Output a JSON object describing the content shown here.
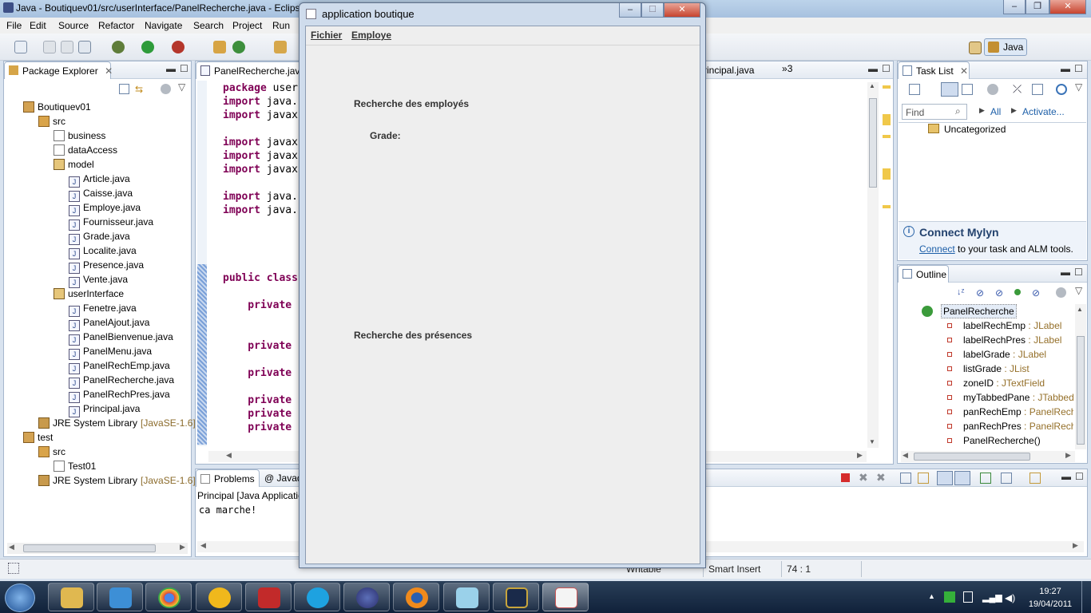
{
  "eclipse": {
    "title": "Java - Boutiquev01/src/userInterface/PanelRecherche.java - Eclipse",
    "menu": [
      "File",
      "Edit",
      "Source",
      "Refactor",
      "Navigate",
      "Search",
      "Project",
      "Run"
    ],
    "perspective": "Java",
    "package_explorer": {
      "title": "Package Explorer",
      "tree": [
        {
          "label": "Boutiquev01",
          "icon": "project-icon",
          "indent": 0
        },
        {
          "label": "src",
          "icon": "source-folder-icon",
          "indent": 1
        },
        {
          "label": "business",
          "icon": "empty-package-icon",
          "indent": 2
        },
        {
          "label": "dataAccess",
          "icon": "empty-package-icon",
          "indent": 2
        },
        {
          "label": "model",
          "icon": "package-icon",
          "indent": 2
        },
        {
          "label": "Article.java",
          "icon": "java-file-icon",
          "indent": 3
        },
        {
          "label": "Caisse.java",
          "icon": "java-file-icon",
          "indent": 3
        },
        {
          "label": "Employe.java",
          "icon": "java-file-icon",
          "indent": 3
        },
        {
          "label": "Fournisseur.java",
          "icon": "java-file-icon",
          "indent": 3
        },
        {
          "label": "Grade.java",
          "icon": "java-file-icon",
          "indent": 3
        },
        {
          "label": "Localite.java",
          "icon": "java-file-icon",
          "indent": 3
        },
        {
          "label": "Presence.java",
          "icon": "java-file-icon",
          "indent": 3
        },
        {
          "label": "Vente.java",
          "icon": "java-file-icon",
          "indent": 3
        },
        {
          "label": "userInterface",
          "icon": "package-icon",
          "indent": 2
        },
        {
          "label": "Fenetre.java",
          "icon": "java-file-icon",
          "indent": 3
        },
        {
          "label": "PanelAjout.java",
          "icon": "java-file-icon",
          "indent": 3
        },
        {
          "label": "PanelBienvenue.java",
          "icon": "java-file-icon",
          "indent": 3
        },
        {
          "label": "PanelMenu.java",
          "icon": "java-file-icon",
          "indent": 3
        },
        {
          "label": "PanelRechEmp.java",
          "icon": "java-file-icon",
          "indent": 3
        },
        {
          "label": "PanelRecherche.java",
          "icon": "java-file-icon",
          "indent": 3
        },
        {
          "label": "PanelRechPres.java",
          "icon": "java-file-icon",
          "indent": 3
        },
        {
          "label": "Principal.java",
          "icon": "java-file-icon",
          "indent": 3
        },
        {
          "label": "JRE System Library",
          "suffix": "[JavaSE-1.6]",
          "icon": "library-icon",
          "indent": 1
        },
        {
          "label": "test",
          "icon": "project-icon",
          "indent": 0
        },
        {
          "label": "src",
          "icon": "source-folder-icon",
          "indent": 1
        },
        {
          "label": "Test01",
          "icon": "empty-package-icon",
          "indent": 2
        },
        {
          "label": "JRE System Library",
          "suffix": "[JavaSE-1.6]",
          "icon": "library-icon",
          "indent": 1
        }
      ]
    },
    "editor": {
      "tab_active": "PanelRecherche.java",
      "tab_other": "rincipal.java",
      "tab_overflow": "3",
      "lines": [
        {
          "kw": "package",
          "rest": " user"
        },
        {
          "kw": "import",
          "rest": " java."
        },
        {
          "kw": "import",
          "rest": " javax"
        },
        {
          "kw": "",
          "rest": ""
        },
        {
          "kw": "import",
          "rest": " javax"
        },
        {
          "kw": "import",
          "rest": " javax"
        },
        {
          "kw": "import",
          "rest": " javax"
        },
        {
          "kw": "",
          "rest": ""
        },
        {
          "kw": "import",
          "rest": " java."
        },
        {
          "kw": "import",
          "rest": " java."
        },
        {
          "kw": "",
          "rest": ""
        },
        {
          "kw": "",
          "rest": ""
        },
        {
          "kw": "",
          "rest": ""
        },
        {
          "kw": "",
          "rest": ""
        },
        {
          "kw": "public class",
          "rest": ""
        },
        {
          "kw": "",
          "rest": ""
        },
        {
          "kw": "    private",
          "rest": ""
        },
        {
          "kw": "",
          "rest": ""
        },
        {
          "kw": "",
          "rest": ""
        },
        {
          "kw": "    private",
          "rest": ""
        },
        {
          "kw": "",
          "rest": ""
        },
        {
          "kw": "    private",
          "rest": ""
        },
        {
          "kw": "",
          "rest": ""
        },
        {
          "kw": "    private",
          "rest": ""
        },
        {
          "kw": "    private",
          "rest": ""
        },
        {
          "kw": "    private",
          "rest": ""
        }
      ]
    },
    "task_list": {
      "title": "Task List",
      "find_placeholder": "Find",
      "all_label": "All",
      "activate_label": "Activate...",
      "category": "Uncategorized"
    },
    "mylyn": {
      "title": "Connect Mylyn",
      "link": "Connect",
      "text": " to your task and ALM tools."
    },
    "outline": {
      "title": "Outline",
      "root": "PanelRecherche",
      "members": [
        {
          "name": "labelRechEmp",
          "type": "JLabel"
        },
        {
          "name": "labelRechPres",
          "type": "JLabel"
        },
        {
          "name": "labelGrade",
          "type": "JLabel"
        },
        {
          "name": "listGrade",
          "type": "JList"
        },
        {
          "name": "zoneID",
          "type": "JTextField"
        },
        {
          "name": "myTabbedPane",
          "type": "JTabbed"
        },
        {
          "name": "panRechEmp",
          "type": "PanelRechE"
        },
        {
          "name": "panRechPres",
          "type": "PanelRechP"
        },
        {
          "name": "PanelRecherche()",
          "type": ""
        }
      ]
    },
    "console": {
      "tab_problems": "Problems",
      "tab_javadoc": "Javad",
      "header": "Principal [Java Applicatio",
      "output": "ca marche!"
    },
    "statusbar": {
      "writable": "Writable",
      "insert_mode": "Smart Insert",
      "position": "74 : 1"
    }
  },
  "dialog": {
    "title": "application boutique",
    "menu": [
      "Fichier",
      "Employe"
    ],
    "label_emp_search": "Recherche des employés",
    "label_grade": "Grade:",
    "label_presence_search": "Recherche des présences"
  },
  "taskbar": {
    "time": "19:27",
    "date": "19/04/2011"
  }
}
